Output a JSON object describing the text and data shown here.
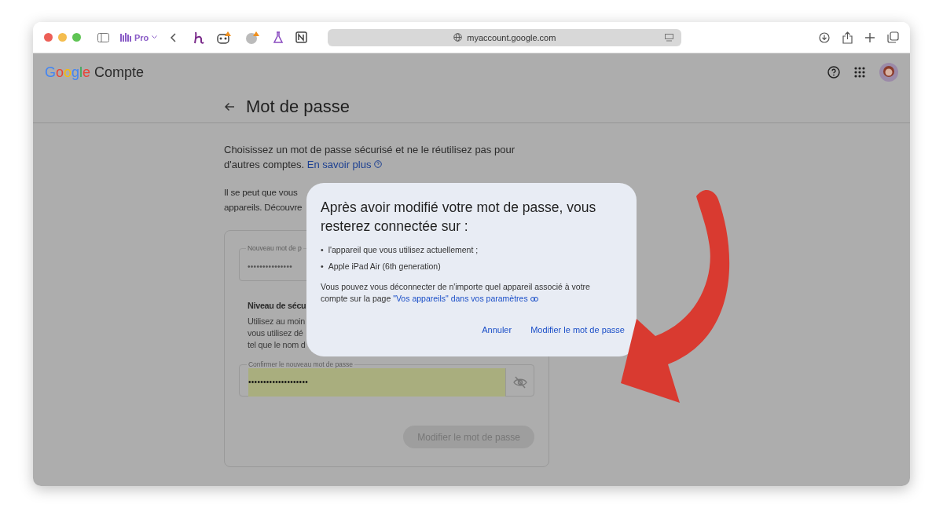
{
  "browser": {
    "tab_group": "Pro",
    "url": "myaccount.google.com"
  },
  "header": {
    "brand_logo": "Google",
    "brand_product": "Compte"
  },
  "title": "Mot de passe",
  "intro": {
    "text": "Choisissez un mot de passe sécurisé et ne le réutilisez pas pour d'autres comptes.",
    "link": "En savoir plus"
  },
  "partial_paragraph": [
    "Il se peut que vous",
    "appareils. Découvre"
  ],
  "card": {
    "new_password": {
      "label": "Nouveau mot de p",
      "value": "•••••••••••••••"
    },
    "strength": {
      "title": "Niveau de sécu",
      "lines": [
        "Utilisez au moin",
        "vous utilisez dé",
        "tel que le nom d"
      ]
    },
    "confirm_password": {
      "label": "Confirmer le nouveau mot de passe",
      "value": "••••••••••••••••••••",
      "highlighted": true
    },
    "submit": {
      "label": "Modifier le mot de passe",
      "disabled": true
    }
  },
  "dialog": {
    "title": "Après avoir modifié votre mot de passe, vous resterez connectée sur :",
    "items": [
      {
        "marker": "•",
        "text": "l'appareil que vous utilisez actuellement ;"
      },
      {
        "marker": "•",
        "text": "Apple iPad Air (6th generation)"
      }
    ],
    "note": "Vous pouvez vous déconnecter de n'importe quel appareil associé à votre compte sur la page",
    "note_link": "\"Vos appareils\" dans vos paramètres",
    "buttons": [
      {
        "label": "Annuler"
      },
      {
        "label": "Modifier le mot de passe"
      }
    ]
  }
}
